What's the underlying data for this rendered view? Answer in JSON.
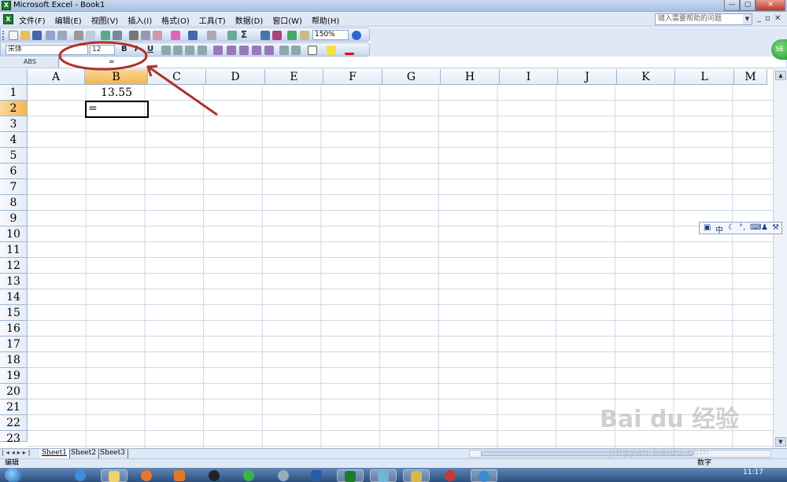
{
  "window": {
    "title": "Microsoft Excel - Book1"
  },
  "menu": {
    "items": [
      "文件(F)",
      "编辑(E)",
      "视图(V)",
      "插入(I)",
      "格式(O)",
      "工具(T)",
      "数据(D)",
      "窗口(W)",
      "帮助(H)"
    ],
    "help_placeholder": "键入需要帮助的问题"
  },
  "toolbar": {
    "zoom": "150%",
    "sigma": "Σ"
  },
  "format_toolbar": {
    "font": "宋体",
    "size": "12",
    "bold": "B",
    "italic": "I",
    "underline": "U"
  },
  "formula_bar": {
    "name_box": "ABS",
    "content": "="
  },
  "grid": {
    "columns": [
      "A",
      "B",
      "C",
      "D",
      "E",
      "F",
      "G",
      "H",
      "I",
      "J",
      "K",
      "L",
      "M"
    ],
    "rows": [
      "1",
      "2",
      "3",
      "4",
      "5",
      "6",
      "7",
      "8",
      "9",
      "10",
      "11",
      "12",
      "13",
      "14",
      "15",
      "16",
      "17",
      "18",
      "19",
      "20",
      "21",
      "22",
      "23"
    ],
    "active_column": "B",
    "active_row": "2",
    "cells": {
      "B1": "13.55",
      "B2": "="
    }
  },
  "sheet_tabs": [
    "Sheet1",
    "Sheet2",
    "Sheet3"
  ],
  "status": {
    "mode": "编辑",
    "right": "数字"
  },
  "taskbar": {
    "clock": "11:17"
  },
  "badge": {
    "text": "56"
  },
  "ime": {
    "mode": "中"
  },
  "watermark": {
    "main": "Bai du 经验",
    "sub": "jingyan.baidu.com"
  },
  "colors": {
    "active_header": "#f1b64e",
    "annotation": "#b0302a",
    "titlebar": "#a9c1e4"
  }
}
